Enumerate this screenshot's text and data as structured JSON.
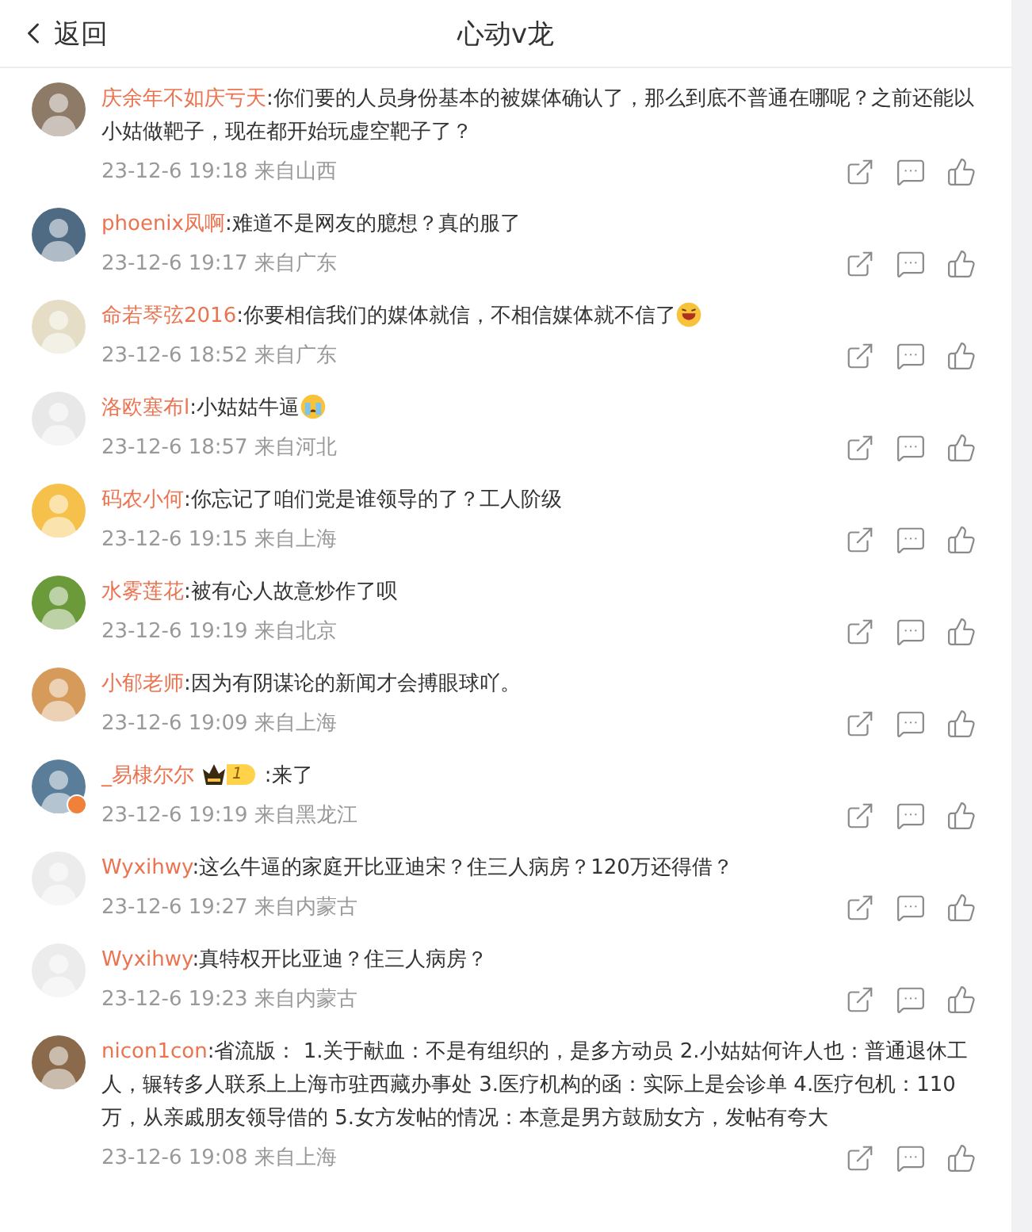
{
  "header": {
    "back_label": "返回",
    "title": "心动v龙"
  },
  "comments": [
    {
      "kind": "plain",
      "name": "庆余年不如庆亏天",
      "text": ":你们要的人员身份基本的被媒体确认了，那么到底不普通在哪呢？之前还能以小姑做靶子，现在都开始玩虚空靶子了？",
      "meta": "23-12-6 19:18 来自山西"
    },
    {
      "kind": "plain",
      "name": "phoenix凤啊",
      "text": ":难道不是网友的臆想？真的服了",
      "meta": "23-12-6 19:17 来自广东"
    },
    {
      "kind": "laugh",
      "name": "命若琴弦2016",
      "text": ":你要相信我们的媒体就信，不相信媒体就不信了",
      "meta": "23-12-6 18:52 来自广东"
    },
    {
      "kind": "cry",
      "name": "洛欧塞布l",
      "text": ":小姑姑牛逼",
      "meta": "23-12-6 18:57 来自河北"
    },
    {
      "kind": "plain",
      "name": "码农小何",
      "text": ":你忘记了咱们党是谁领导的了？工人阶级",
      "meta": "23-12-6 19:15 来自上海"
    },
    {
      "kind": "plain",
      "name": "水雾莲花",
      "text": ":被有心人故意炒作了呗",
      "meta": "23-12-6 19:19 来自北京"
    },
    {
      "kind": "plain",
      "name": "小郁老师",
      "text": ":因为有阴谋论的新闻才会搏眼球吖。",
      "meta": "23-12-6 19:09 来自上海"
    },
    {
      "kind": "plain",
      "name": "_易棣尔尔",
      "badge": "1",
      "verified": true,
      "text": ":来了",
      "meta": "23-12-6 19:19 来自黑龙江"
    },
    {
      "kind": "plain",
      "name": "Wyxihwy",
      "text": ":这么牛逼的家庭开比亚迪宋？住三人病房？120万还得借？",
      "meta": "23-12-6 19:27 来自内蒙古"
    },
    {
      "kind": "plain",
      "name": "Wyxihwy",
      "text": ":真特权开比亚迪？住三人病房？",
      "meta": "23-12-6 19:23 来自内蒙古"
    },
    {
      "kind": "plain",
      "name": "nicon1con",
      "text": ":省流版： 1.关于献血：不是有组织的，是多方动员 2.小姑姑何许人也：普通退休工人，辗转多人联系上上海市驻西藏办事处 3.医疗机构的函：实际上是会诊单 4.医疗包机：110万，从亲戚朋友领导借的 5.女方发帖的情况：本意是男方鼓励女方，发帖有夸大",
      "meta": "23-12-6 19:08 来自上海"
    }
  ]
}
